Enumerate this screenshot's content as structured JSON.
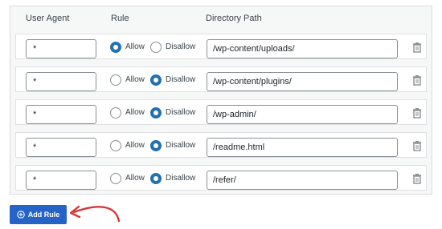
{
  "headers": {
    "user_agent": "User Agent",
    "rule": "Rule",
    "directory_path": "Directory Path"
  },
  "labels": {
    "allow": "Allow",
    "disallow": "Disallow"
  },
  "rows": [
    {
      "user_agent": "*",
      "rule": "allow",
      "path": "/wp-content/uploads/"
    },
    {
      "user_agent": "*",
      "rule": "disallow",
      "path": "/wp-content/plugins/"
    },
    {
      "user_agent": "*",
      "rule": "disallow",
      "path": "/wp-admin/"
    },
    {
      "user_agent": "*",
      "rule": "disallow",
      "path": "/readme.html"
    },
    {
      "user_agent": "*",
      "rule": "disallow",
      "path": "/refer/"
    }
  ],
  "add_button": {
    "label": "Add Rule",
    "icon": "plus-circle-icon"
  },
  "colors": {
    "accent": "#2563c7",
    "annotation_arrow": "#d63638"
  }
}
